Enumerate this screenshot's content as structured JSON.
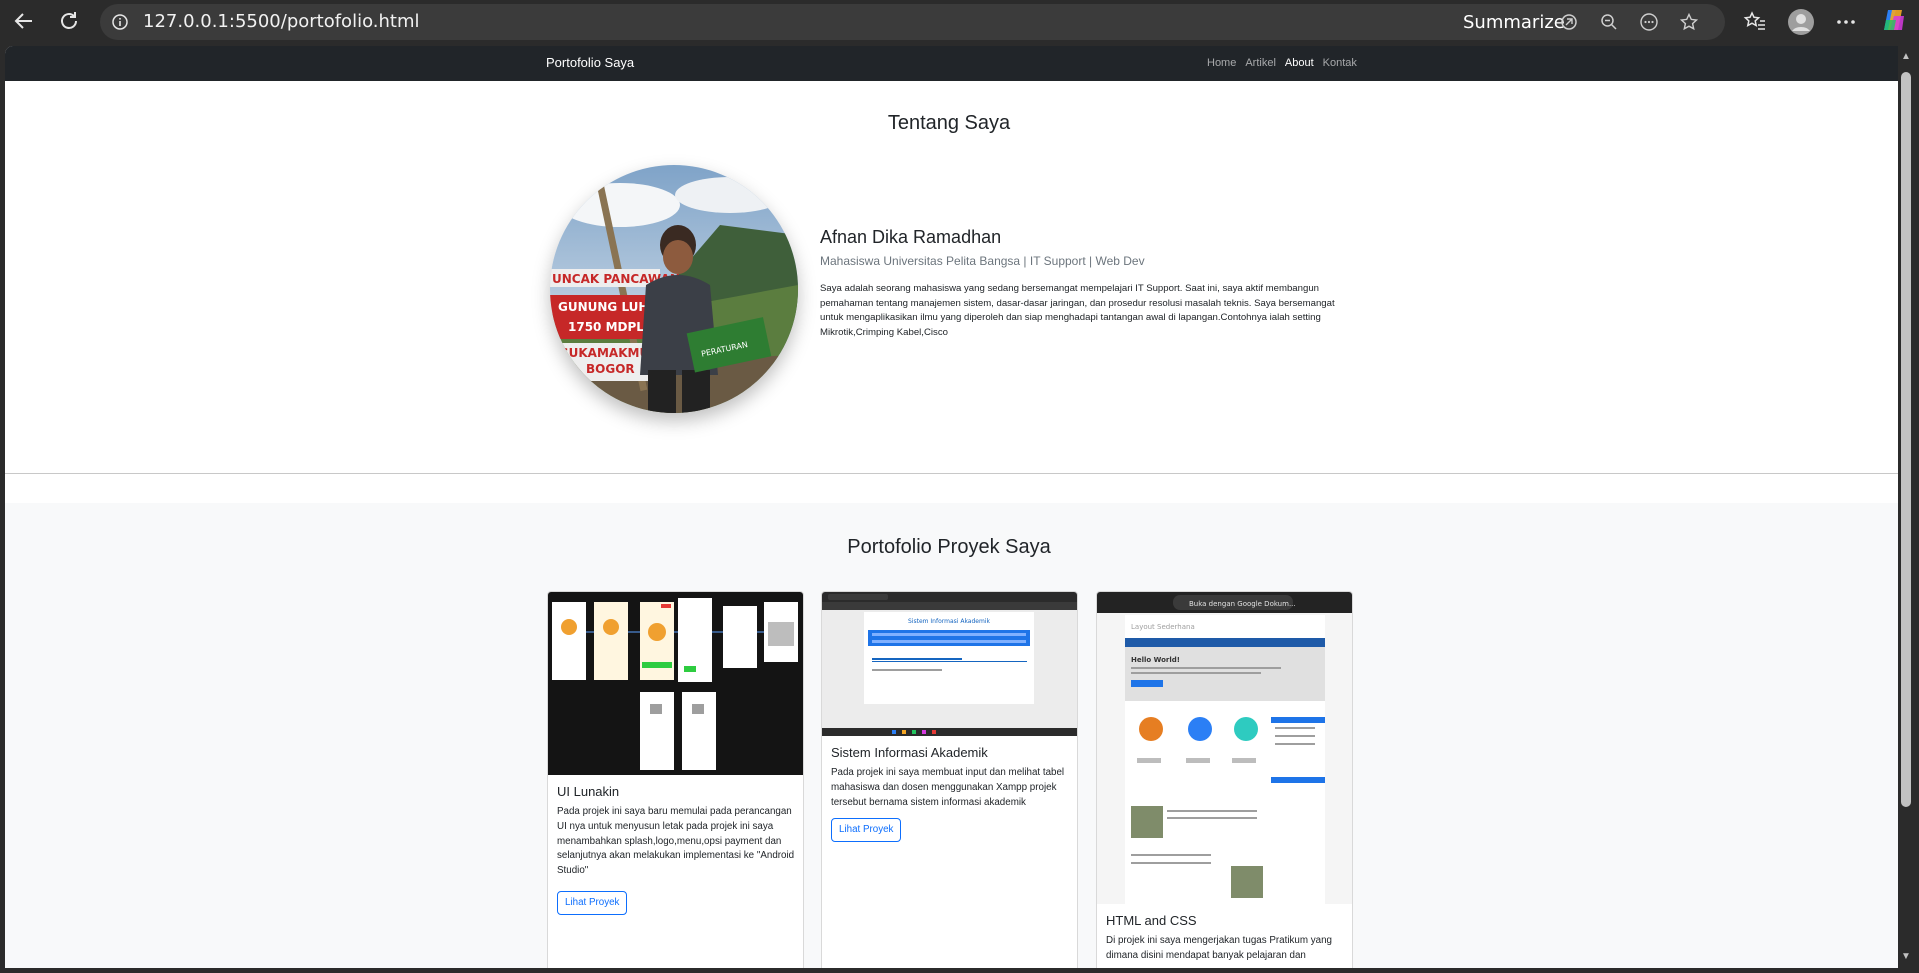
{
  "browser": {
    "url": "127.0.0.1:5500/portofolio.html",
    "summarize_label": "Summarize",
    "icons": [
      "back-icon",
      "refresh-icon",
      "info-icon",
      "summarize-icon",
      "zoom-icon",
      "more-icon",
      "favorite-icon",
      "favorites-icon",
      "profile-icon",
      "menu-icon",
      "copilot-icon"
    ]
  },
  "navbar": {
    "brand": "Portofolio Saya",
    "links": [
      {
        "label": "Home",
        "active": false
      },
      {
        "label": "Artikel",
        "active": false
      },
      {
        "label": "About",
        "active": true
      },
      {
        "label": "Kontak",
        "active": false
      }
    ]
  },
  "about": {
    "title": "Tentang Saya",
    "name": "Afnan Dika Ramadhan",
    "subtitle": "Mahasiswa Universitas Pelita Bangsa | IT Support | Web Dev",
    "description": "Saya adalah seorang mahasiswa yang sedang bersemangat mempelajari IT Support. Saat ini, saya aktif membangun pemahaman tentang manajemen sistem, dasar-dasar jaringan, dan prosedur resolusi masalah teknis. Saya bersemangat untuk mengaplikasikan ilmu yang diperoleh dan siap menghadapi tantangan awal di lapangan.Contohnya ialah setting Mikrotik,Crimping Kabel,Cisco",
    "photo_sign": [
      "UNCAK PANCAWAN",
      "GUNUNG LUH",
      "1750 MDPL",
      "SUKAMAKMUR",
      "BOGOR"
    ]
  },
  "portfolio": {
    "title": "Portofolio Proyek Saya",
    "projects": [
      {
        "title": "UI Lunakin",
        "text": "Pada projek ini saya baru memulai pada perancangan UI nya untuk menyusun letak pada projek ini saya menambahkan splash,logo,menu,opsi payment dan selanjutnya akan melakukan implementasi ke \"Android Studio\"",
        "button": "Lihat Proyek"
      },
      {
        "title": "Sistem Informasi Akademik",
        "text": "Pada projek ini saya membuat input dan melihat tabel mahasiswa dan dosen menggunakan Xampp projek tersebut bernama sistem informasi akademik",
        "button": "Lihat Proyek",
        "screenshot_heading": "Sistem Informasi Akademik"
      },
      {
        "title": "HTML and CSS",
        "text": "Di projek ini saya mengerjakan tugas Pratikum yang dimana disini mendapat banyak pelajaran dan",
        "screenshot_toolbar": "Buka dengan Google Dokum...",
        "screenshot_heading": "Layout Sederhana",
        "screenshot_hello": "Hello World!"
      }
    ]
  },
  "colors": {
    "navbar_bg": "#212529",
    "button_primary": "#0d6efd",
    "section_bg": "#f8f9fa"
  }
}
